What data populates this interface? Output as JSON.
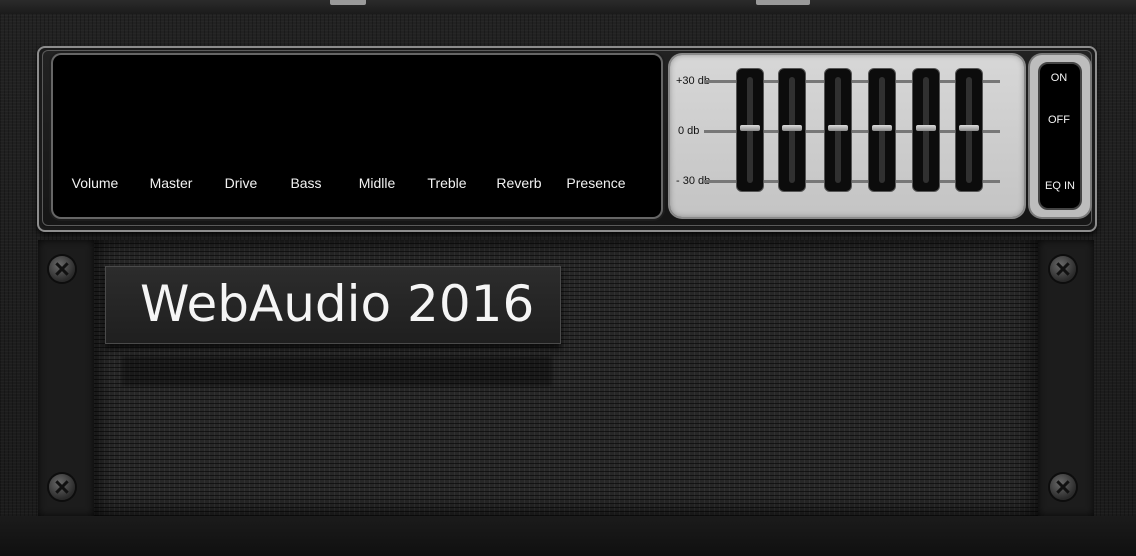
{
  "controls": {
    "labels": [
      "Volume",
      "Master",
      "Drive",
      "Bass",
      "Midlle",
      "Treble",
      "Reverb",
      "Presence"
    ]
  },
  "eq": {
    "scale_labels": [
      "+30 db",
      "0 db",
      "- 30 db"
    ],
    "bands": [
      {
        "value_db": 0
      },
      {
        "value_db": 0
      },
      {
        "value_db": 0
      },
      {
        "value_db": 0
      },
      {
        "value_db": 0
      },
      {
        "value_db": 0
      }
    ]
  },
  "switch": {
    "on_label": "ON",
    "off_label": "OFF",
    "eq_in_label": "EQ IN"
  },
  "badge": {
    "title": "WebAudio 2016"
  },
  "colors": {
    "panel_bg": "#000000",
    "eq_panel": "#cfcfcf",
    "text_light": "#f2f2f2"
  }
}
